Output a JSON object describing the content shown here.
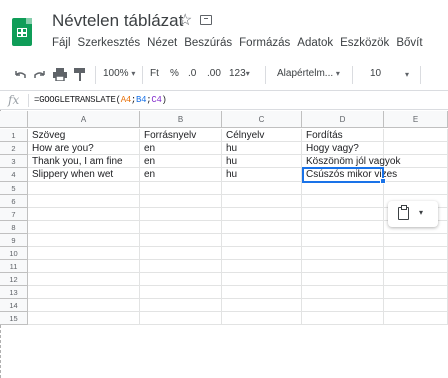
{
  "app": {
    "title": "Névtelen táblázat",
    "icons": {
      "logo": "google-sheets-logo",
      "star": "star-icon",
      "folder": "move-to-folder-icon"
    }
  },
  "menu": [
    "Fájl",
    "Szerkesztés",
    "Nézet",
    "Beszúrás",
    "Formázás",
    "Adatok",
    "Eszközök",
    "Bővít"
  ],
  "toolbar": {
    "zoom": "100%",
    "currency": "Ft",
    "percent": "%",
    "decrease_decimal": ".0",
    "increase_decimal": ".00",
    "more_formats": "123",
    "font": "Alapértelm...",
    "font_size": "10"
  },
  "formula_bar": {
    "fx": "fx",
    "prefix": "=GOOGLETRANSLATE(",
    "ref1": "A4",
    "sep1": ";",
    "ref2": "B4",
    "sep2": ";",
    "ref3": "C4",
    "suffix": ")"
  },
  "sheet": {
    "columns": [
      "A",
      "B",
      "C",
      "D",
      "E"
    ],
    "row_numbers": [
      "1",
      "2",
      "3",
      "4",
      "5",
      "6",
      "7",
      "8",
      "9",
      "10",
      "11",
      "12",
      "13",
      "14",
      "15"
    ],
    "rows": [
      [
        "Szöveg",
        "Forrásnyelv",
        "Célnyelv",
        "Fordítás"
      ],
      [
        "How are you?",
        "en",
        "hu",
        "Hogy vagy?"
      ],
      [
        "Thank you, I am fine",
        "en",
        "hu",
        "Köszönöm jól vagyok"
      ],
      [
        "Slippery when wet",
        "en",
        "hu",
        "Csúszós mikor vizes"
      ]
    ],
    "selected_cell": "D4"
  },
  "colors": {
    "accent": "#1a73e8",
    "sheets_green": "#0f9d58"
  }
}
